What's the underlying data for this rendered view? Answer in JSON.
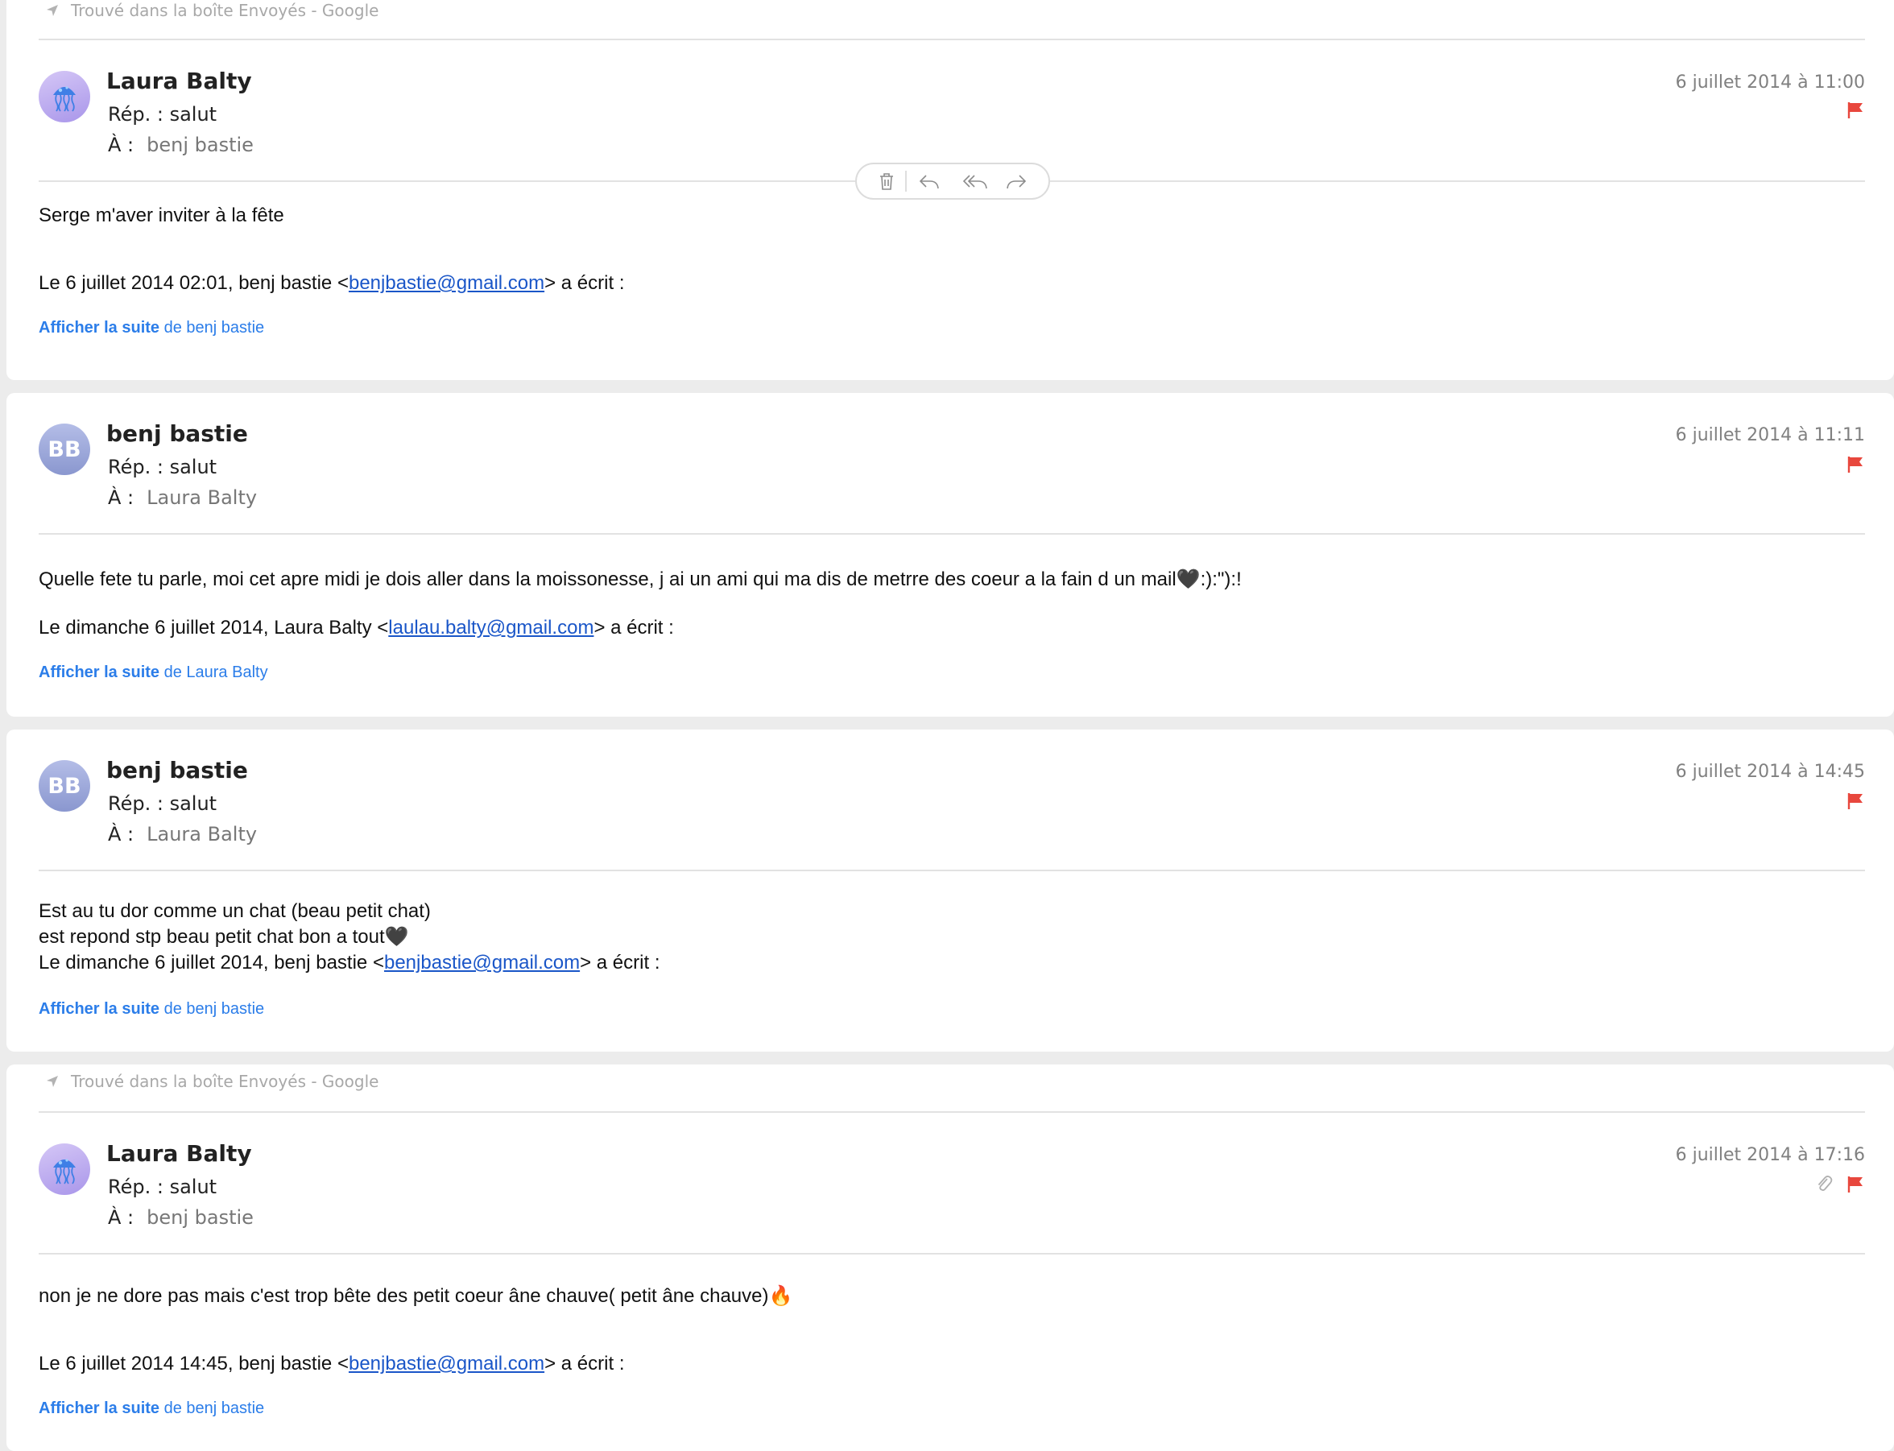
{
  "messages": [
    {
      "found_in": "Trouvé dans la boîte Envoyés - Google",
      "sender": "Laura Balty",
      "avatar": "jellyfish-avatar",
      "subject": "Rép. : salut",
      "to_label": "À :",
      "to": "benj bastie",
      "date": "6 juillet 2014 à 11:00",
      "flagged": true,
      "body_line": "Serge m'aver inviter à la fête",
      "quote_prefix": "Le 6 juillet 2014 02:01, benj bastie <",
      "quote_email": "benjbastie@gmail.com",
      "quote_suffix": "> a écrit :",
      "show_more_bold": "Afficher la suite",
      "show_more_rest": " de benj bastie"
    },
    {
      "sender": "benj bastie",
      "avatar_initials": "BB",
      "subject": "Rép. : salut",
      "to_label": "À :",
      "to": "Laura Balty",
      "date": "6 juillet 2014 à 11:11",
      "flagged": true,
      "body_line": "Quelle fete tu parle, moi cet apre midi je dois aller dans la moissonesse, j ai un ami qui ma dis de metrre des coeur a la fain d un mail🖤:):\"):!",
      "quote_prefix": "Le dimanche 6 juillet 2014, Laura Balty <",
      "quote_email": "laulau.balty@gmail.com",
      "quote_suffix": "> a écrit :",
      "show_more_bold": "Afficher la suite",
      "show_more_rest": " de Laura Balty"
    },
    {
      "sender": "benj bastie",
      "avatar_initials": "BB",
      "subject": "Rép. : salut",
      "to_label": "À :",
      "to": "Laura Balty",
      "date": "6 juillet 2014 à 14:45",
      "flagged": true,
      "body_line_1": "Est au tu dor comme un chat (beau petit chat)",
      "body_line_2": "est repond stp beau petit chat bon a tout🖤",
      "quote_prefix": "Le dimanche 6 juillet 2014, benj bastie <",
      "quote_email": "benjbastie@gmail.com",
      "quote_suffix": "> a écrit :",
      "show_more_bold": "Afficher la suite",
      "show_more_rest": " de benj bastie"
    },
    {
      "found_in": "Trouvé dans la boîte Envoyés - Google",
      "sender": "Laura Balty",
      "avatar": "jellyfish-avatar",
      "subject": "Rép. : salut",
      "to_label": "À :",
      "to": "benj bastie",
      "date": "6 juillet 2014 à 17:16",
      "flagged": true,
      "has_attachment": true,
      "body_line": "non je ne dore pas mais c'est trop bête des petit coeur âne chauve( petit âne chauve)🔥",
      "quote_prefix": "Le 6 juillet 2014 14:45, benj bastie <",
      "quote_email": "benjbastie@gmail.com",
      "quote_suffix": "> a écrit :",
      "show_more_bold": "Afficher la suite",
      "show_more_rest": " de benj bastie"
    }
  ],
  "toolbar": {
    "icons": [
      "trash-icon",
      "reply-icon",
      "reply-all-icon",
      "forward-icon"
    ]
  },
  "colors": {
    "link": "#1a56c8",
    "show_more": "#2b7de9",
    "flag": "#e8473d",
    "meta_gray": "#808080"
  }
}
